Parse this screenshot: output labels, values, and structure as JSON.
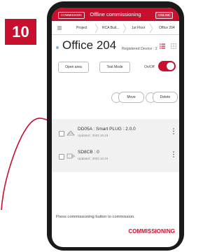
{
  "step_number": "10",
  "colors": {
    "accent": "#c8102e",
    "phone_frame": "#1a1a1a",
    "list_bg": "#f1f1f1"
  },
  "topbar": {
    "mode_left": "COMMISSION",
    "title": "Offline commissioning",
    "mode_right": "ONLINE"
  },
  "breadcrumb": {
    "menu_icon": "menu-icon",
    "items": [
      "Project",
      "RCA Buil...",
      "1st Floor",
      "Office 204"
    ]
  },
  "room": {
    "name": "Office 204",
    "registered_label": "Registered Device : 2"
  },
  "controls": {
    "open_area": "Open area",
    "test_mode": "Test Mode",
    "on_off_label": "On/Off",
    "move": "Move",
    "delete": "Delete"
  },
  "devices": [
    {
      "name": "DD05A : Smart PLUG : 2.0.0",
      "updated": "Updated : 2023.10.23",
      "icon": "plug-icon"
    },
    {
      "name": "SD8CB : 0",
      "updated": "Updated : 2023.10.23",
      "icon": "sensor-icon"
    }
  ],
  "footer": {
    "hint": "Press commissioning button to commission.",
    "commission_button": "COMMISSIONING"
  }
}
